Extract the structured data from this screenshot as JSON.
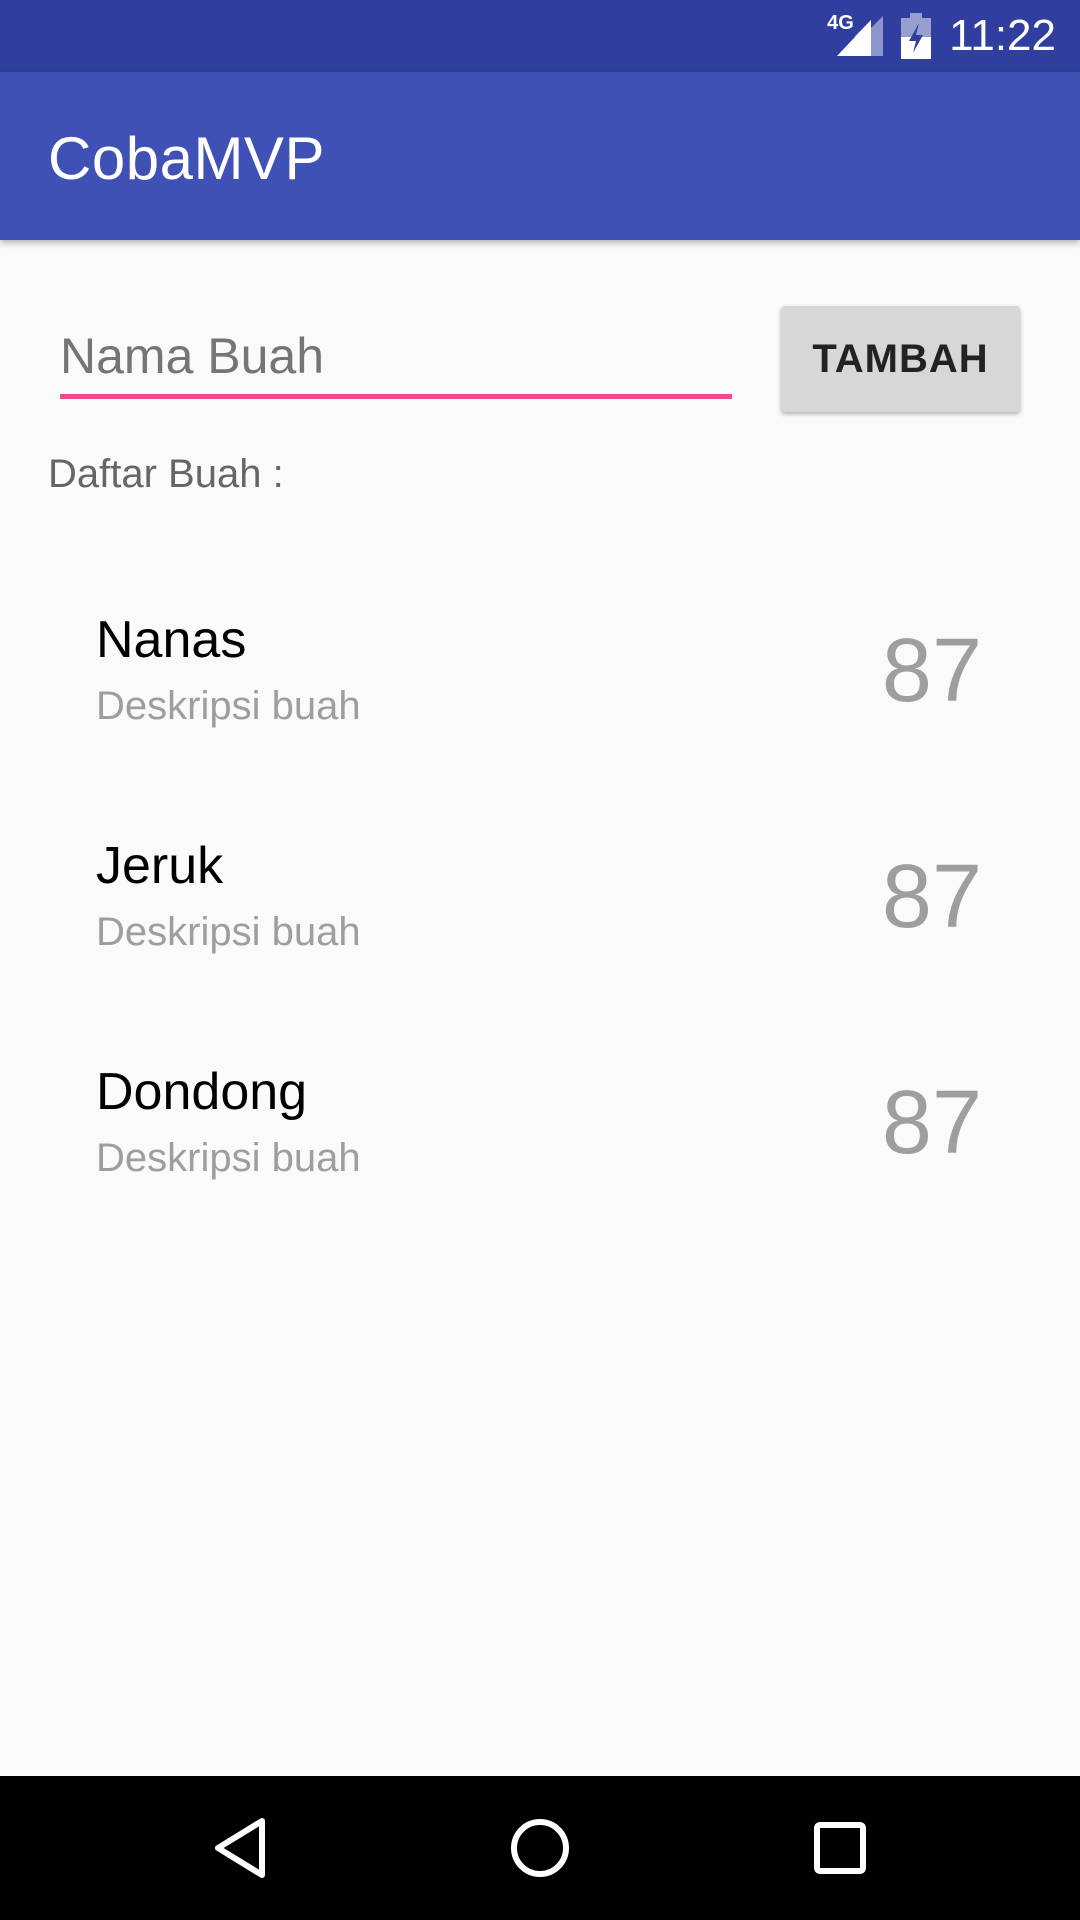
{
  "status_bar": {
    "network_type": "4G",
    "time": "11:22",
    "icons": [
      "signal-icon",
      "battery-charging-icon"
    ]
  },
  "app_bar": {
    "title": "CobaMVP"
  },
  "form": {
    "input_placeholder": "Nama Buah",
    "input_value": "",
    "add_button_label": "TAMBAH",
    "accent_color": "#f04a8a"
  },
  "list": {
    "label": "Daftar Buah :",
    "items": [
      {
        "name": "Nanas",
        "description": "Deskripsi buah",
        "value": "87"
      },
      {
        "name": "Jeruk",
        "description": "Deskripsi buah",
        "value": "87"
      },
      {
        "name": "Dondong",
        "description": "Deskripsi buah",
        "value": "87"
      }
    ]
  },
  "nav_bar": {
    "icons": [
      "back-icon",
      "home-icon",
      "recents-icon"
    ]
  },
  "colors": {
    "primary": "#3f51b5",
    "primary_dark": "#303f9f",
    "background": "#fafafa"
  }
}
